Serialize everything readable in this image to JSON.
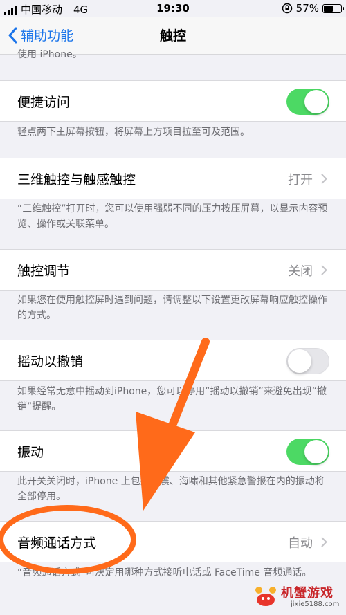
{
  "status_bar": {
    "carrier": "中国移动",
    "network": "4G",
    "time": "19:30",
    "battery": "57%",
    "battery_level": 0.57
  },
  "nav": {
    "back_label": "辅助功能",
    "title": "触控"
  },
  "cut_text": "使用 iPhone。",
  "rows": [
    {
      "label": "便捷访问",
      "control": "toggle",
      "state": "on",
      "note": "轻点两下主屏幕按钮，将屏幕上方项目拉至可及范围。"
    },
    {
      "label": "三维触控与触感触控",
      "control": "disclosure",
      "value": "打开",
      "note": "“三维触控”打开时，您可以使用强弱不同的压力按压屏幕，以显示内容预览、操作或关联菜单。"
    },
    {
      "label": "触控调节",
      "control": "disclosure",
      "value": "关闭",
      "note": "如果您在使用触控屏时遇到问题，请调整以下设置更改屏幕响应触控操作的方式。"
    },
    {
      "label": "摇动以撤销",
      "control": "toggle",
      "state": "off",
      "note": "如果经常无意中摇动到iPhone，您可以停用“摇动以撤销”来避免出现“撤销”提醒。"
    },
    {
      "label": "振动",
      "control": "toggle",
      "state": "on",
      "note": "此开关关闭时，iPhone 上包括地震、海啸和其他紧急警报在内的振动将全部停用。"
    },
    {
      "label": "音频通话方式",
      "control": "disclosure",
      "value": "自动",
      "note": "“音频通话方式”可决定用哪种方式接听电话或 FaceTime 音频通话。"
    }
  ],
  "watermark": {
    "title": "机蟹游戏",
    "url": "jixie5188.com"
  },
  "colors": {
    "accent": "#1a74ea",
    "toggle_on": "#4cd964",
    "annotation": "#ff6a1a",
    "background": "#f1f1f6"
  }
}
